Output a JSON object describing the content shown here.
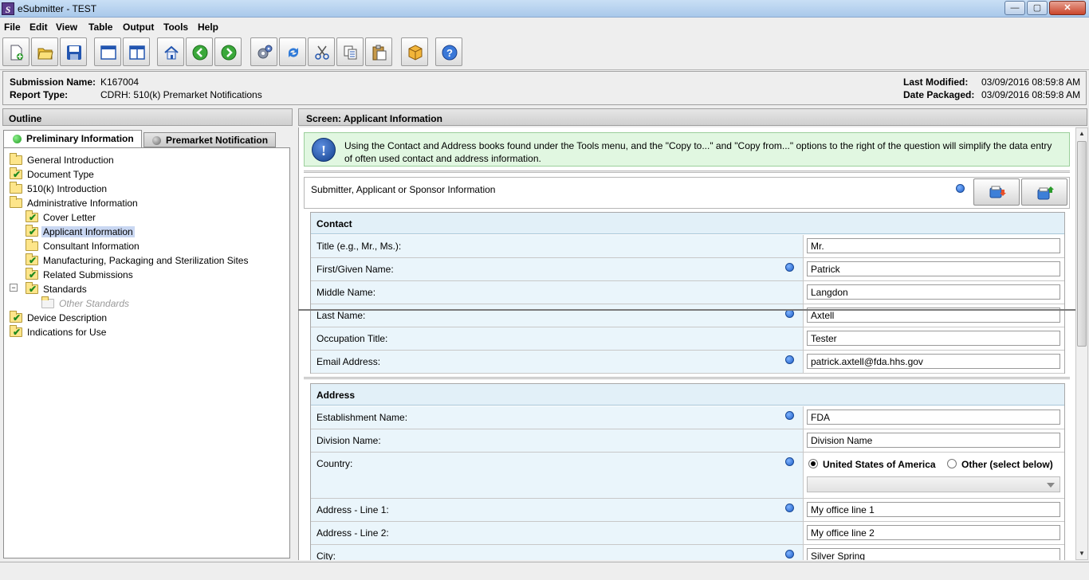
{
  "window": {
    "title": "eSubmitter - TEST",
    "app_icon": "S",
    "controls": {
      "minimize": "—",
      "maximize": "▢",
      "close": "✕"
    }
  },
  "menu": [
    "File",
    "Edit",
    "View",
    "Table",
    "Output",
    "Tools",
    "Help"
  ],
  "toolbar": [
    {
      "name": "new-document-icon"
    },
    {
      "name": "open-folder-icon"
    },
    {
      "name": "save-icon"
    },
    {
      "name": "single-pane-icon"
    },
    {
      "name": "split-pane-icon"
    },
    {
      "name": "home-icon"
    },
    {
      "name": "back-arrow-icon"
    },
    {
      "name": "forward-arrow-icon"
    },
    {
      "name": "gears-icon"
    },
    {
      "name": "refresh-icon"
    },
    {
      "name": "cut-icon"
    },
    {
      "name": "copy-icon"
    },
    {
      "name": "paste-icon"
    },
    {
      "name": "package-icon"
    },
    {
      "name": "help-icon"
    }
  ],
  "info": {
    "submission_name_label": "Submission Name:",
    "submission_name": "K167004",
    "report_type_label": "Report Type:",
    "report_type": "CDRH: 510(k) Premarket Notifications",
    "last_modified_label": "Last Modified:",
    "last_modified": "03/09/2016 08:59:8 AM",
    "date_packaged_label": "Date Packaged:",
    "date_packaged": "03/09/2016 08:59:8 AM"
  },
  "outline": {
    "header": "Outline",
    "tabs": [
      {
        "label": "Preliminary Information",
        "dot": "#22aa22"
      },
      {
        "label": "Premarket Notification",
        "dot": "#777777"
      }
    ],
    "tree": [
      {
        "label": "General Introduction",
        "level": 0,
        "checked": false
      },
      {
        "label": "Document Type",
        "level": 0,
        "checked": true
      },
      {
        "label": "510(k) Introduction",
        "level": 0,
        "checked": false
      },
      {
        "label": "Administrative Information",
        "level": 0,
        "checked": false
      },
      {
        "label": "Cover Letter",
        "level": 1,
        "checked": true
      },
      {
        "label": "Applicant Information",
        "level": 1,
        "checked": true,
        "selected": true
      },
      {
        "label": "Consultant Information",
        "level": 1,
        "checked": false
      },
      {
        "label": "Manufacturing, Packaging and Sterilization Sites",
        "level": 1,
        "checked": true
      },
      {
        "label": "Related Submissions",
        "level": 1,
        "checked": true
      },
      {
        "label": "Standards",
        "level": 1,
        "checked": true,
        "expander": "−"
      },
      {
        "label": "Other Standards",
        "level": 2,
        "checked": false,
        "disabled": true
      },
      {
        "label": "Device Description",
        "level": 0,
        "checked": true
      },
      {
        "label": "Indications for Use",
        "level": 0,
        "checked": true
      }
    ]
  },
  "screen": {
    "header": "Screen: Applicant Information",
    "hint_icon": "!",
    "hint": "Using the Contact and Address books found under the Tools menu, and the \"Copy to...\" and \"Copy from...\" options to the right of the question will simplify the data entry of often used contact and address information.",
    "section_title": "Submitter, Applicant or Sponsor Information",
    "contact": {
      "header": "Contact",
      "rows": [
        {
          "label": "Title (e.g., Mr., Ms.):",
          "value": "Mr.",
          "required": false
        },
        {
          "label": "First/Given Name:",
          "value": "Patrick",
          "required": true
        },
        {
          "label": "Middle Name:",
          "value": "Langdon",
          "required": false
        },
        {
          "label": "Last Name:",
          "value": "Axtell",
          "required": true
        },
        {
          "label": "Occupation Title:",
          "value": "Tester",
          "required": false
        },
        {
          "label": "Email Address:",
          "value": "patrick.axtell@fda.hhs.gov",
          "required": true
        }
      ]
    },
    "address": {
      "header": "Address",
      "rows": [
        {
          "label": "Establishment Name:",
          "value": "FDA",
          "required": true
        },
        {
          "label": "Division Name:",
          "value": "Division Name",
          "required": false
        },
        {
          "label": "Address - Line 1:",
          "value": "My office line 1",
          "required": true
        },
        {
          "label": "Address - Line 2:",
          "value": "My office line 2",
          "required": false
        },
        {
          "label": "City:",
          "value": "Silver Spring",
          "required": true
        }
      ],
      "country": {
        "label": "Country:",
        "option_us": "United States of America",
        "option_other": "Other (select below)",
        "selected": "us",
        "select_value": ""
      }
    }
  }
}
